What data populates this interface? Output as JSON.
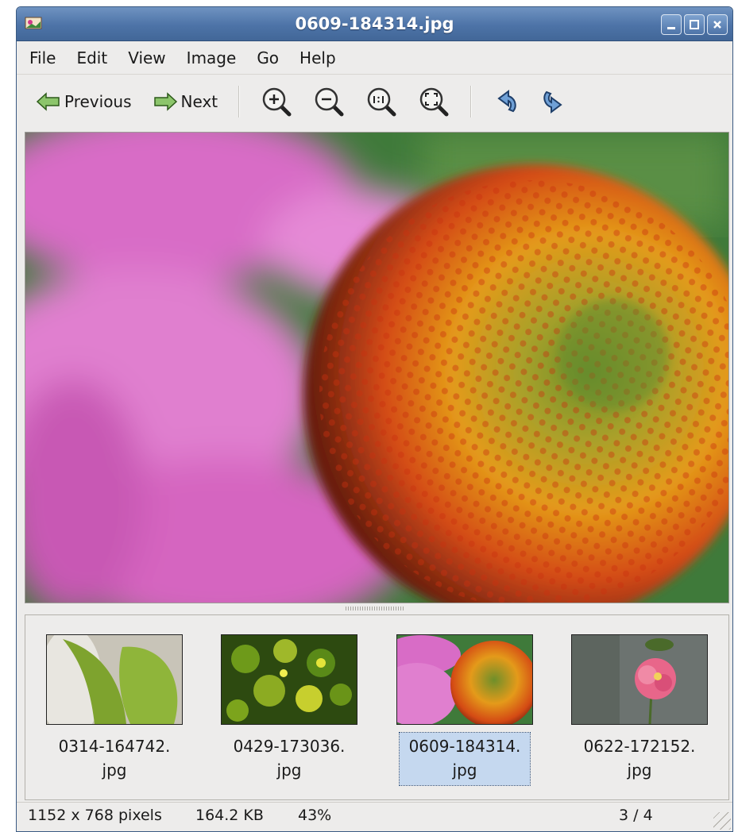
{
  "window": {
    "title": "0609-184314.jpg"
  },
  "menu": [
    "File",
    "Edit",
    "View",
    "Image",
    "Go",
    "Help"
  ],
  "toolbar": {
    "previous_label": "Previous",
    "next_label": "Next",
    "icons": [
      "zoom-in-icon",
      "zoom-out-icon",
      "zoom-normal-icon",
      "zoom-fit-icon",
      "rotate-left-icon",
      "rotate-right-icon"
    ]
  },
  "thumbnails": [
    {
      "line1": "0314-164742.",
      "line2": "jpg",
      "selected": false
    },
    {
      "line1": "0429-173036.",
      "line2": "jpg",
      "selected": false
    },
    {
      "line1": "0609-184314.",
      "line2": "jpg",
      "selected": true
    },
    {
      "line1": "0622-172152.",
      "line2": "jpg",
      "selected": false
    }
  ],
  "status": {
    "dimensions": "1152 x 768 pixels",
    "filesize": "164.2 KB",
    "zoom": "43%",
    "position": "3 / 4"
  },
  "colors": {
    "titlebar": "#4d73a7",
    "selection": "#c5d8ef"
  }
}
